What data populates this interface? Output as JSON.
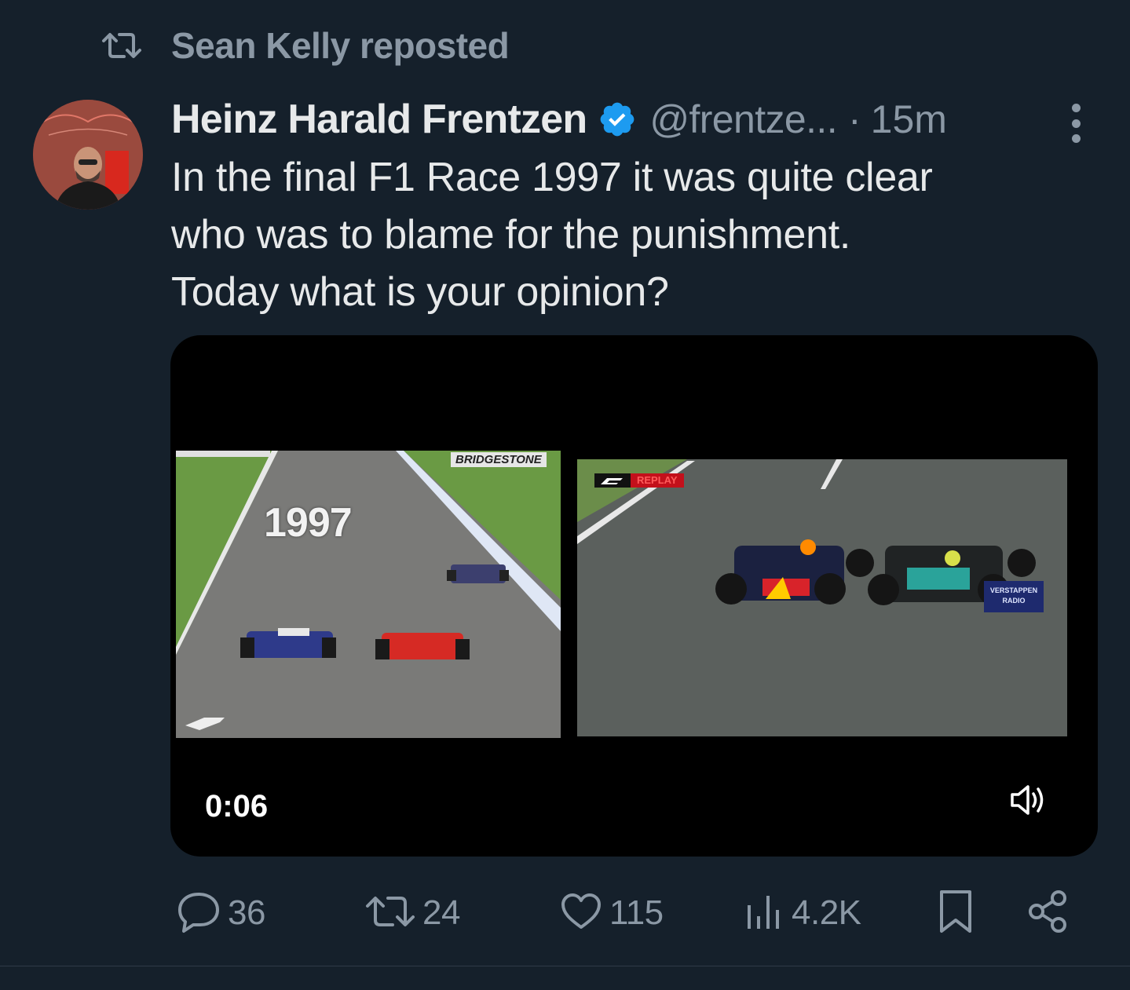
{
  "repost": {
    "label": "Sean Kelly reposted",
    "icon": "repost-icon"
  },
  "tweet": {
    "author_name": "Heinz Harald Frentzen",
    "verified": true,
    "handle": "@frentze...",
    "separator": "·",
    "time": "15m",
    "text_lines": [
      "In the final F1 Race 1997 it was quite clear",
      "who was to blame for the punishment.",
      "Today what is your opinion?"
    ]
  },
  "media": {
    "type": "video",
    "duration": "0:06",
    "left_frame": {
      "overlay_text": "1997",
      "sponsor_text": "BRIDGESTONE"
    },
    "right_frame": {
      "badge_text": "REPLAY",
      "radio_lines": [
        "VERSTAPPEN",
        "RADIO"
      ]
    },
    "volume_icon": "volume-icon"
  },
  "actions": {
    "replies": "36",
    "reposts": "24",
    "likes": "115",
    "views": "4.2K",
    "bookmark_icon": "bookmark-icon",
    "share_icon": "share-icon"
  },
  "colors": {
    "background": "#15202b",
    "text_primary": "#e7e9ea",
    "text_secondary": "#8b98a5",
    "verified_blue": "#1d9bf0"
  }
}
